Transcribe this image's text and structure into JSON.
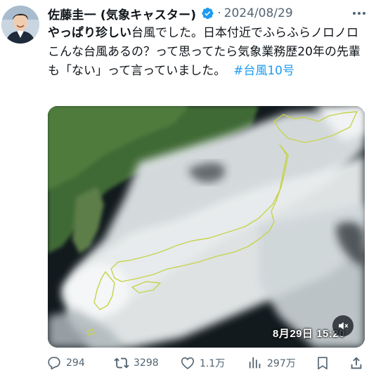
{
  "author": {
    "name": "佐藤圭一 (気象キャスター)",
    "date": "2024/08/29",
    "dot": "·"
  },
  "tweet": {
    "text_bold": "やっぱり珍しい",
    "text_rest": "台風でした。日本付近でふらふらノロノロこんな台風あるの？って思ってたら気象業務歴20年の先輩も「ない」って言っていました。",
    "hashtag": "#台風10号"
  },
  "media": {
    "timestamp": "8月29日 15:20"
  },
  "actions": {
    "replies": "294",
    "reposts": "3298",
    "likes": "1.1万",
    "views": "297万"
  },
  "colors": {
    "accent": "#1d9bf0",
    "text": "#0f1419",
    "secondary": "#536471"
  }
}
